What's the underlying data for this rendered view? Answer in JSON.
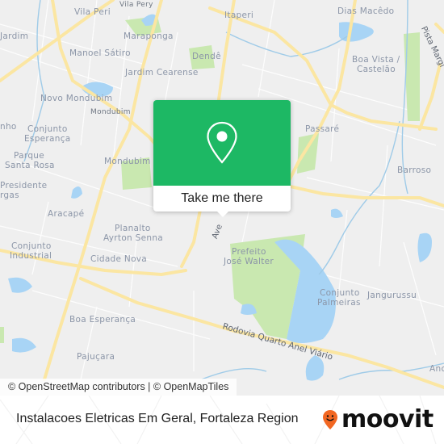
{
  "map": {
    "colors": {
      "background": "#efefef",
      "road_major": "#fbe6a2",
      "road_minor": "#ffffff",
      "water": "#a8d4f5",
      "park": "#c9e8b0",
      "label": "#8c96a8"
    },
    "places": [
      {
        "name": "Vila Pery",
        "kind": "small"
      },
      {
        "name": "Vila Peri",
        "kind": "neighborhood"
      },
      {
        "name": "Itaperi",
        "kind": "neighborhood"
      },
      {
        "name": "Dias Macêdo",
        "kind": "neighborhood"
      },
      {
        "name": "Jardim",
        "kind": "neighborhood"
      },
      {
        "name": "Maraponga",
        "kind": "neighborhood"
      },
      {
        "name": "Manoel Sátiro",
        "kind": "neighborhood"
      },
      {
        "name": "Dendê",
        "kind": "neighborhood"
      },
      {
        "name": "Boa Vista /",
        "kind": "neighborhood"
      },
      {
        "name": "Castelão",
        "kind": "neighborhood"
      },
      {
        "name": "Jardim Cearense",
        "kind": "neighborhood"
      },
      {
        "name": "Novo Mondubim",
        "kind": "neighborhood"
      },
      {
        "name": "Mondubim",
        "kind": "small"
      },
      {
        "name": "nho",
        "kind": "neighborhood"
      },
      {
        "name": "Conjunto",
        "kind": "neighborhood"
      },
      {
        "name": "Esperança",
        "kind": "neighborhood"
      },
      {
        "name": "Passaré",
        "kind": "neighborhood"
      },
      {
        "name": "Parque",
        "kind": "neighborhood"
      },
      {
        "name": "Santa Rosa",
        "kind": "neighborhood"
      },
      {
        "name": "Mondubim",
        "kind": "neighborhood"
      },
      {
        "name": "Barroso",
        "kind": "neighborhood"
      },
      {
        "name": "Presidente",
        "kind": "neighborhood"
      },
      {
        "name": "rgas",
        "kind": "neighborhood"
      },
      {
        "name": "Aracapé",
        "kind": "neighborhood"
      },
      {
        "name": "Planalto",
        "kind": "neighborhood"
      },
      {
        "name": "Ayrton Senna",
        "kind": "neighborhood"
      },
      {
        "name": "Conjunto",
        "kind": "neighborhood"
      },
      {
        "name": "Industrial",
        "kind": "neighborhood"
      },
      {
        "name": "Cidade Nova",
        "kind": "neighborhood"
      },
      {
        "name": "Prefeito",
        "kind": "neighborhood"
      },
      {
        "name": "José Walter",
        "kind": "neighborhood"
      },
      {
        "name": "Conjunto",
        "kind": "neighborhood"
      },
      {
        "name": "Palmeiras",
        "kind": "neighborhood"
      },
      {
        "name": "Jangurussu",
        "kind": "neighborhood"
      },
      {
        "name": "Boa Esperança",
        "kind": "neighborhood"
      },
      {
        "name": "Pajuçara",
        "kind": "neighborhood"
      },
      {
        "name": "Anc",
        "kind": "neighborhood"
      }
    ],
    "roads": [
      {
        "name": "Rodovia Quarto Anel Viário"
      },
      {
        "name": "Pista Margi"
      },
      {
        "name": "Ave"
      }
    ],
    "attribution": "© OpenStreetMap contributors | © OpenMapTiles"
  },
  "popup": {
    "icon": "map-pin-icon",
    "color": "#1db864",
    "cta_label": "Take me there"
  },
  "footer": {
    "place_name": "Instalacoes Eletricas Em Geral, Fortaleza Region",
    "logo_text": "moovit",
    "logo_color": "#f26722"
  }
}
